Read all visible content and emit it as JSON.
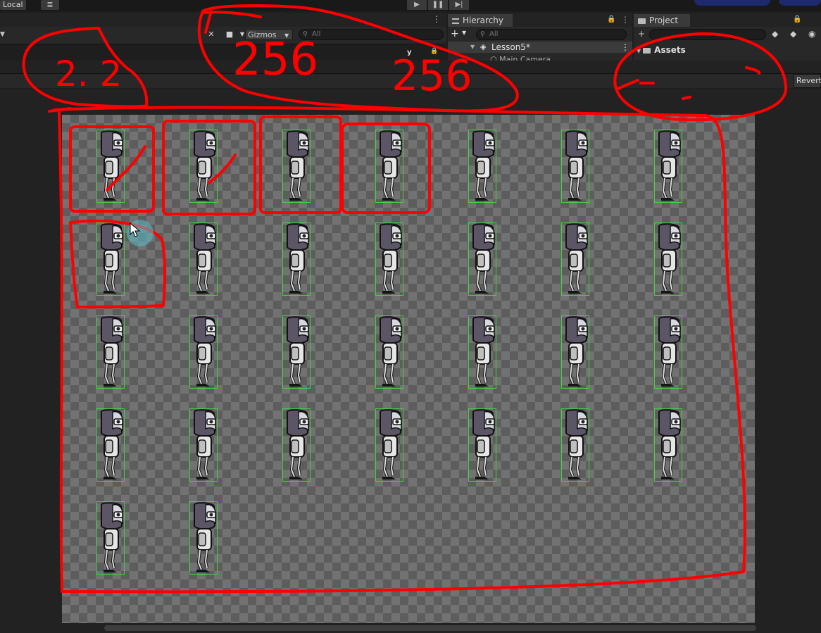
{
  "top_bar": {
    "local_label": "Local",
    "layers_icon": "layers-icon",
    "play_icons": [
      "play-icon",
      "pause-icon",
      "step-icon"
    ]
  },
  "scene_toolbar": {
    "tool_icons": [
      "move-tool-icon",
      "camera-icon",
      "chevron-down-icon"
    ],
    "gizmos_label": "Gizmos",
    "search_placeholder": "All",
    "axis_label": "y"
  },
  "hierarchy": {
    "tab_label": "Hierarchy",
    "search_placeholder": "All",
    "scene_name": "Lesson5*",
    "camera_item": "Main Camera"
  },
  "project": {
    "tab_label": "Project",
    "root_folder": "Assets"
  },
  "inspector_bar": {
    "revert_label": "Revert"
  },
  "sprite_sheet": {
    "columns": 7,
    "rows": 5,
    "frame_count": 30,
    "outline_color": "#3ed43e",
    "checker_light": "#727272",
    "checker_dark": "#5d5d5d"
  },
  "annotations": {
    "color": "#ff0000",
    "texts": [
      "2. 2",
      "256",
      "256"
    ]
  }
}
